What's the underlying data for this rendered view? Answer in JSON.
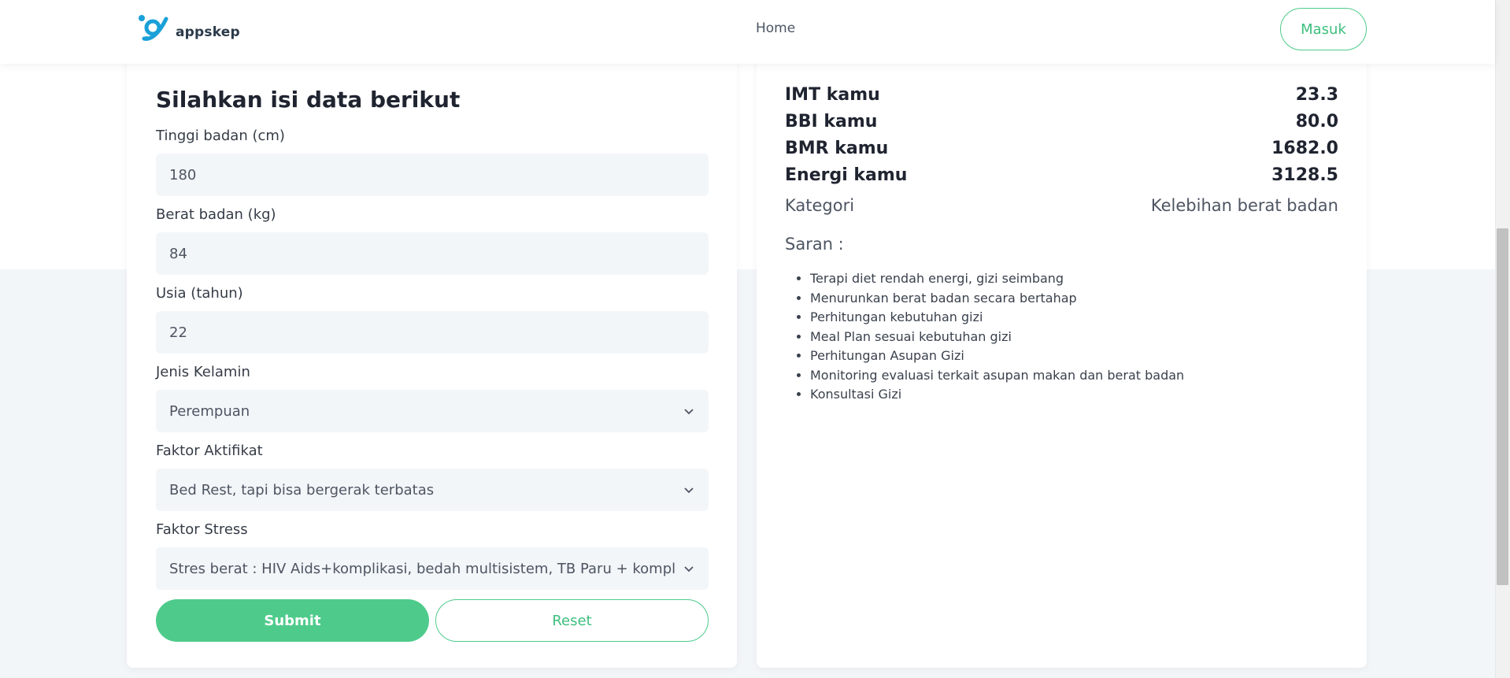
{
  "navbar": {
    "brand": "appskep",
    "home_link": "Home",
    "login_button": "Masuk"
  },
  "form": {
    "title": "Silahkan isi data berikut",
    "height": {
      "label": "Tinggi badan (cm)",
      "value": "180"
    },
    "weight": {
      "label": "Berat badan (kg)",
      "value": "84"
    },
    "age": {
      "label": "Usia (tahun)",
      "value": "22"
    },
    "gender": {
      "label": "Jenis Kelamin",
      "value": "Perempuan"
    },
    "activity": {
      "label": "Faktor Aktifikat",
      "value": "Bed Rest, tapi bisa bergerak terbatas"
    },
    "stress": {
      "label": "Faktor Stress",
      "value": "Stres berat : HIV Aids+komplikasi, bedah multisistem, TB Paru + komplikasi"
    },
    "submit_label": "Submit",
    "reset_label": "Reset"
  },
  "result": {
    "stats": [
      {
        "label": "IMT kamu",
        "value": "23.3"
      },
      {
        "label": "BBI kamu",
        "value": "80.0"
      },
      {
        "label": "BMR kamu",
        "value": "1682.0"
      },
      {
        "label": "Energi kamu",
        "value": "3128.5"
      }
    ],
    "category": {
      "label": "Kategori",
      "value": "Kelebihan berat badan"
    },
    "advice_title": "Saran :",
    "advice": [
      "Terapi diet rendah energi, gizi seimbang",
      "Menurunkan berat badan secara bertahap",
      "Perhitungan kebutuhan gizi",
      "Meal Plan sesuai kebutuhan gizi",
      "Perhitungan Asupan Gizi",
      "Monitoring evaluasi terkait asupan makan dan berat badan",
      "Konsultasi Gizi"
    ]
  },
  "colors": {
    "accent": "#4ecb8b",
    "page_bg": "#f3f6f9",
    "heading": "#1f2430"
  },
  "icons": {
    "logo": "appskep-logo",
    "select_arrow": "chevron-down-icon"
  }
}
